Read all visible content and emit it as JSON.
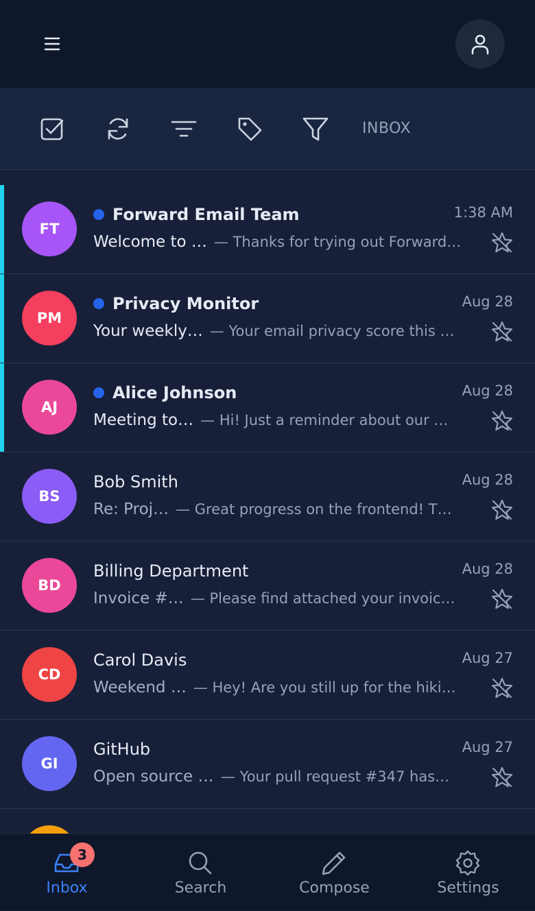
{
  "header": {
    "menu_icon": "hamburger-menu-icon",
    "profile_icon": "user-icon"
  },
  "toolbar": {
    "tools": [
      "select-all-icon",
      "refresh-icon",
      "sort-icon",
      "label-icon",
      "filter-icon"
    ],
    "folder_label": "INBOX"
  },
  "emails": [
    {
      "initials": "FT",
      "avatar_color": "#a855f7",
      "sender": "Forward Email Team",
      "date": "1:38 AM",
      "subject": "Welcome to …",
      "snippet": "— Thanks for trying out Forward…",
      "unread": true
    },
    {
      "initials": "PM",
      "avatar_color": "#f43f5e",
      "sender": "Privacy Monitor",
      "date": "Aug 28",
      "subject": "Your weekly…",
      "snippet": "— Your email privacy score this …",
      "unread": true
    },
    {
      "initials": "AJ",
      "avatar_color": "#ec4899",
      "sender": "Alice Johnson",
      "date": "Aug 28",
      "subject": "Meeting to…",
      "snippet": "— Hi! Just a reminder about our …",
      "unread": true
    },
    {
      "initials": "BS",
      "avatar_color": "#8b5cf6",
      "sender": "Bob Smith",
      "date": "Aug 28",
      "subject": "Re: Proj…",
      "snippet": "— Great progress on the frontend! T…",
      "unread": false
    },
    {
      "initials": "BD",
      "avatar_color": "#ec4899",
      "sender": "Billing Department",
      "date": "Aug 28",
      "subject": "Invoice #…",
      "snippet": "— Please find attached your invoic…",
      "unread": false
    },
    {
      "initials": "CD",
      "avatar_color": "#ef4444",
      "sender": "Carol Davis",
      "date": "Aug 27",
      "subject": "Weekend …",
      "snippet": "— Hey! Are you still up for the hiki…",
      "unread": false
    },
    {
      "initials": "GI",
      "avatar_color": "#6366f1",
      "sender": "GitHub",
      "date": "Aug 27",
      "subject": "Open source c…",
      "snippet": "— Your pull request #347 has…",
      "unread": false
    }
  ],
  "partial_row": {
    "avatar_color": "#f59e0b"
  },
  "bottom_nav": {
    "items": [
      {
        "label": "Inbox",
        "icon": "inbox-icon",
        "active": true,
        "badge": "3"
      },
      {
        "label": "Search",
        "icon": "search-icon",
        "active": false
      },
      {
        "label": "Compose",
        "icon": "pencil-icon",
        "active": false
      },
      {
        "label": "Settings",
        "icon": "gear-icon",
        "active": false
      }
    ]
  },
  "colors": {
    "accent": "#22d3ee",
    "unread_dot": "#2563eb",
    "active_nav": "#3b82f6",
    "badge": "#f87171"
  }
}
